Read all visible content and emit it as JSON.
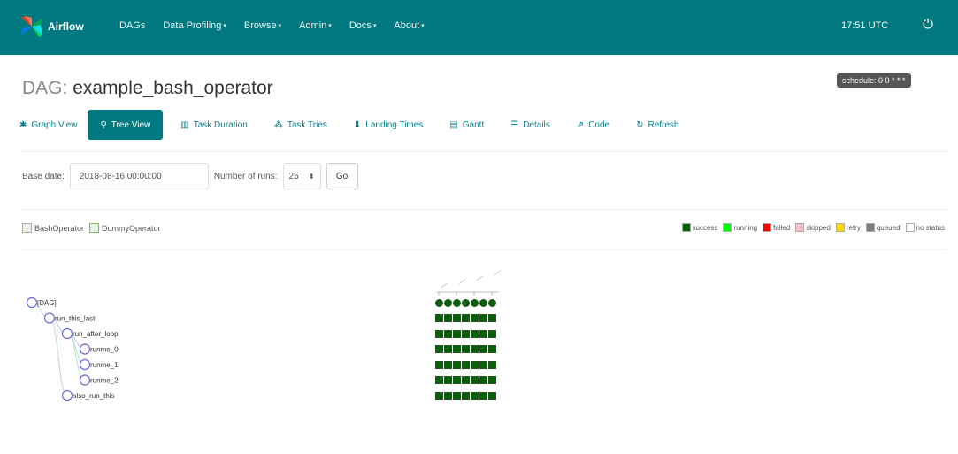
{
  "brand": {
    "name": "Airflow"
  },
  "nav": {
    "items": [
      {
        "label": "DAGs",
        "dropdown": false
      },
      {
        "label": "Data Profiling",
        "dropdown": true
      },
      {
        "label": "Browse",
        "dropdown": true
      },
      {
        "label": "Admin",
        "dropdown": true
      },
      {
        "label": "Docs",
        "dropdown": true
      },
      {
        "label": "About",
        "dropdown": true
      }
    ],
    "time": "17:51 UTC",
    "power_icon": "power-icon"
  },
  "dag": {
    "prefix": "DAG:",
    "name": "example_bash_operator",
    "schedule": "schedule: 0 0 * * *"
  },
  "tabs": [
    {
      "label": "Graph View",
      "icon": "graph-icon",
      "active": false
    },
    {
      "label": "Tree View",
      "icon": "tree-icon",
      "active": true
    },
    {
      "label": "Task Duration",
      "icon": "bar-chart-icon",
      "active": false
    },
    {
      "label": "Task Tries",
      "icon": "tries-icon",
      "active": false
    },
    {
      "label": "Landing Times",
      "icon": "arrow-down-icon",
      "active": false
    },
    {
      "label": "Gantt",
      "icon": "gantt-icon",
      "active": false
    },
    {
      "label": "Details",
      "icon": "details-icon",
      "active": false
    },
    {
      "label": "Code",
      "icon": "code-icon",
      "active": false
    },
    {
      "label": "Refresh",
      "icon": "refresh-icon",
      "active": false
    }
  ],
  "form": {
    "base_date_label": "Base date:",
    "base_date_value": "2018-08-16 00:00:00",
    "num_runs_label": "Number of runs:",
    "num_runs_value": "25",
    "go_label": "Go"
  },
  "operators": [
    {
      "label": "BashOperator",
      "color": "#f0ede4"
    },
    {
      "label": "DummyOperator",
      "color": "#e8f7e4"
    }
  ],
  "states": [
    {
      "label": "success",
      "color": "#006400"
    },
    {
      "label": "running",
      "color": "#00ff00"
    },
    {
      "label": "failed",
      "color": "#ff0000"
    },
    {
      "label": "skipped",
      "color": "#ffc0cb"
    },
    {
      "label": "retry",
      "color": "#ffd700"
    },
    {
      "label": "queued",
      "color": "#808080"
    },
    {
      "label": "no status",
      "color": "#ffffff"
    }
  ],
  "tree": {
    "nodes": [
      {
        "label": "[DAG]",
        "depth": 0
      },
      {
        "label": "run_this_last",
        "depth": 1
      },
      {
        "label": "run_after_loop",
        "depth": 2
      },
      {
        "label": "runme_0",
        "depth": 3
      },
      {
        "label": "runme_1",
        "depth": 3
      },
      {
        "label": "runme_2",
        "depth": 3
      },
      {
        "label": "also_run_this",
        "depth": 2
      }
    ],
    "run_count": 7,
    "cell_color": "#006400"
  }
}
